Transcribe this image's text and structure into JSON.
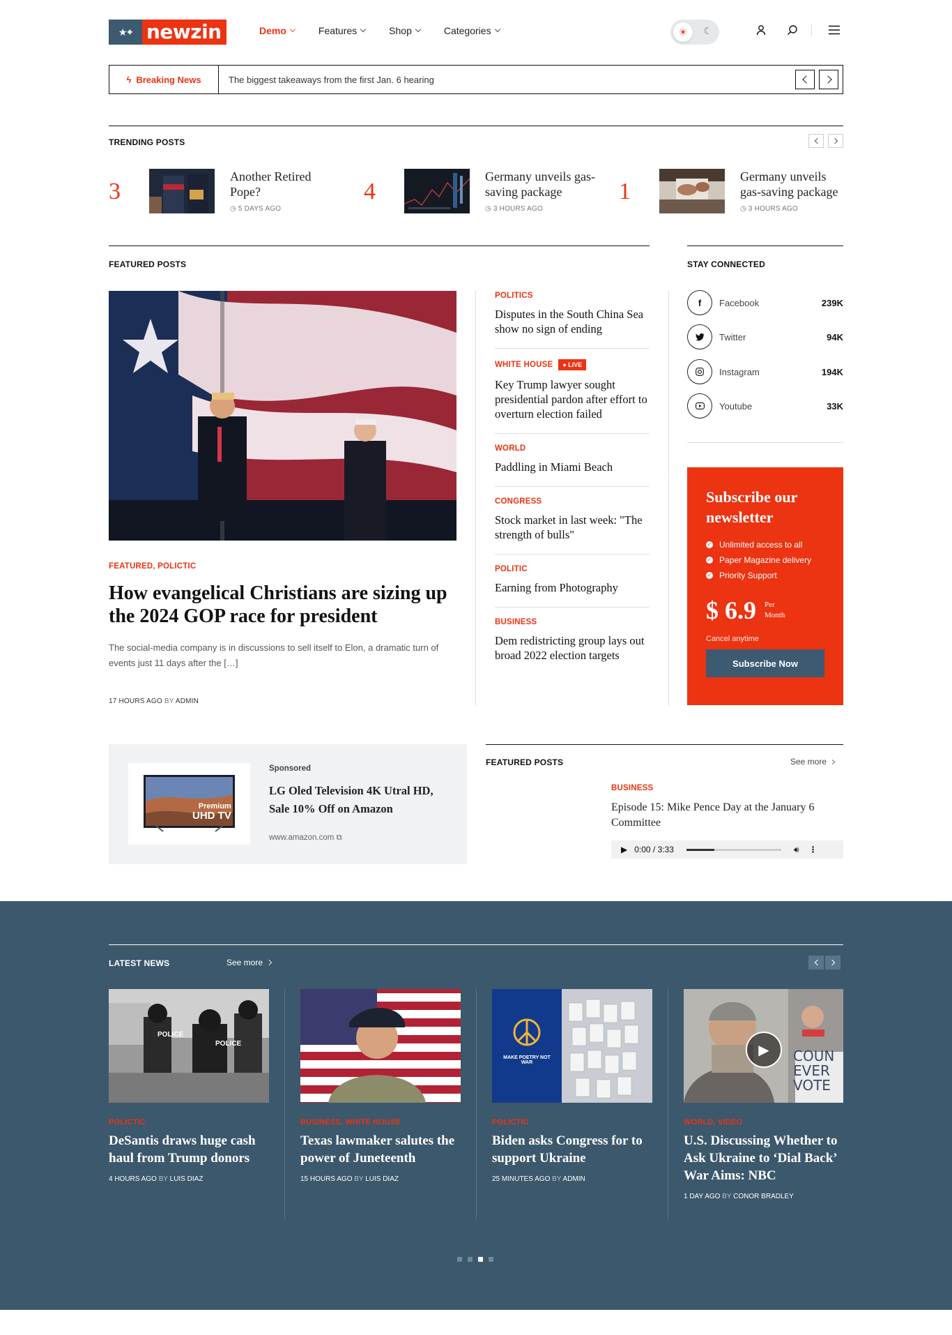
{
  "brand": {
    "logo_text": "newzin",
    "accent": "#ec3312",
    "navy": "#3d5a70"
  },
  "nav": [
    {
      "label": "Demo",
      "active": true
    },
    {
      "label": "Features"
    },
    {
      "label": "Shop"
    },
    {
      "label": "Categories"
    }
  ],
  "breaking": {
    "label": "Breaking News",
    "text": "The biggest takeaways from the first Jan. 6 hearing"
  },
  "trending": {
    "title": "TRENDING POSTS",
    "items": [
      {
        "rank": "3",
        "title": "Another Retired Pope?",
        "time": "5 DAYS AGO"
      },
      {
        "rank": "4",
        "title": "Germany unveils gas-saving package",
        "time": "3 HOURS AGO"
      },
      {
        "rank": "1",
        "title": "Germany unveils gas-saving package",
        "time": "3 HOURS AGO"
      }
    ]
  },
  "featured": {
    "title": "FEATURED POSTS",
    "main": {
      "categories": "FEATURED, POLICTIC",
      "title": "How evangelical Christians are sizing up the 2024 GOP race for president",
      "excerpt": "The social-media company is in discussions to sell itself to Elon, a dramatic turn of events just 11 days after the […]",
      "time": "17 HOURS AGO",
      "by": "BY",
      "author": "ADMIN"
    },
    "list": [
      {
        "cat": "POLITICS",
        "title": "Disputes in the South China Sea show no sign of ending"
      },
      {
        "cat": "WHITE HOUSE",
        "live": "LIVE",
        "title": "Key Trump lawyer sought presidential pardon after effort to overturn election failed"
      },
      {
        "cat": "WORLD",
        "title": "Paddling in Miami Beach"
      },
      {
        "cat": "CONGRESS",
        "title": "Stock market in last week: \"The strength of bulls\""
      },
      {
        "cat": "POLITIC",
        "title": "Earning from Photography"
      },
      {
        "cat": "BUSINESS",
        "title": "Dem redistricting group lays out broad 2022 election targets"
      }
    ]
  },
  "social": {
    "title": "STAY CONNECTED",
    "items": [
      {
        "icon": "facebook-icon",
        "name": "Facebook",
        "count": "239K"
      },
      {
        "icon": "twitter-icon",
        "name": "Twitter",
        "count": "94K"
      },
      {
        "icon": "instagram-icon",
        "name": "Instagram",
        "count": "194K"
      },
      {
        "icon": "youtube-icon",
        "name": "Youtube",
        "count": "33K"
      }
    ]
  },
  "newsletter": {
    "title": "Subscribe our newsletter",
    "perks": [
      "Unlimited access to all",
      "Paper Magazine delivery",
      "Priority Support"
    ],
    "price": "$ 6.9",
    "per": "Per",
    "period": "Month",
    "cancel": "Cancel anytime",
    "button": "Subscribe Now"
  },
  "sponsored": {
    "label": "Sponsored",
    "title": "LG Oled Television 4K Utral HD, Sale 10% Off on Amazon",
    "url": "www.amazon.com",
    "tv_text_1": "Premium",
    "tv_text_2": "UHD TV"
  },
  "podcast": {
    "title": "FEATURED POSTS",
    "see_more": "See more",
    "cat": "BUSINESS",
    "episode": "Episode 15: Mike Pence Day at the January 6 Committee",
    "time": "0:00 / 3:33"
  },
  "latest": {
    "title": "LATEST NEWS",
    "see_more": "See more",
    "items": [
      {
        "cat": "POLICTIC",
        "title": "DeSantis draws huge cash haul from Trump donors",
        "time": "4 HOURS AGO",
        "by": "BY",
        "author": "LUIS DIAZ"
      },
      {
        "cat": "BUSINESS, WHITE HOUSE",
        "title": "Texas lawmaker salutes the power of Juneteenth",
        "time": "15 HOURS AGO",
        "by": "BY",
        "author": "LUIS DIAZ"
      },
      {
        "cat": "POLICTIC",
        "title": "Biden asks Congress for to support Ukraine",
        "time": "25 MINUTES AGO",
        "by": "BY",
        "author": "ADMIN"
      },
      {
        "cat": "WORLD, VIDEO",
        "title": "U.S. Discussing Whether to Ask Ukraine to ‘Dial Back’ War Aims: NBC",
        "time": "1 DAY AGO",
        "by": "BY",
        "author": "CONOR BRADLEY"
      }
    ],
    "poster_text": "MAKE POETRY NOT WAR",
    "sign_text": "COUN EVER VOTE",
    "police_text": "POLICE",
    "pager": {
      "pages": 4,
      "active": 3
    }
  }
}
